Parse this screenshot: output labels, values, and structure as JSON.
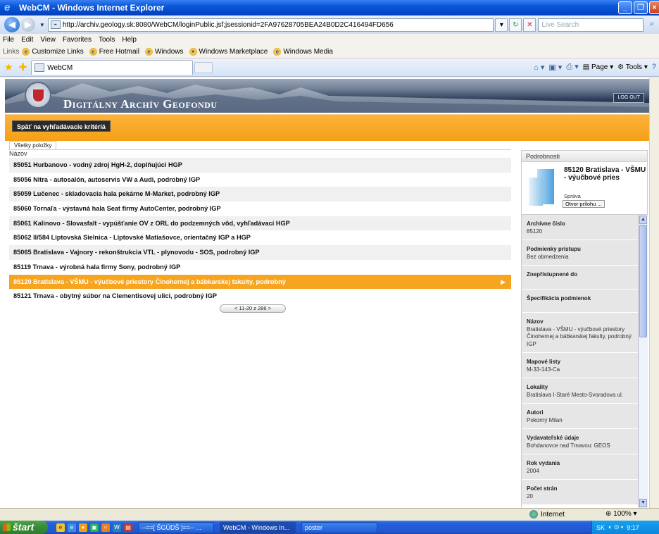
{
  "window": {
    "title": "WebCM - Windows Internet Explorer"
  },
  "address": {
    "url": "http://archiv.geology.sk:8080/WebCM/loginPublic.jsf;jsessionid=2FA97628705BEA24B0D2C416494FD656",
    "search_placeholder": "Live Search"
  },
  "menu": [
    "File",
    "Edit",
    "View",
    "Favorites",
    "Tools",
    "Help"
  ],
  "links": {
    "label": "Links",
    "items": [
      "Customize Links",
      "Free Hotmail",
      "Windows",
      "Windows Marketplace",
      "Windows Media"
    ]
  },
  "tab": {
    "label": "WebCM"
  },
  "commandbar": {
    "page": "Page",
    "tools": "Tools"
  },
  "site": {
    "title": "Digitálny Archív Geofondu",
    "logout": "LOG OUT",
    "back_button": "Späť na vyhľadávacie kritériá",
    "list_tab": "Všetky položky",
    "column_header": "Názov",
    "pager": "< 11-20 z 286 >"
  },
  "results": [
    "85051 Hurbanovo - vodný zdroj HgH-2, doplňujúci HGP",
    "85056 Nitra - autosalón, autoservis VW a Audi, podrobný IGP",
    "85059 Lučenec - skladovacia hala pekárne M-Market, podrobný IGP",
    "85060 Tornaľa - výstavná hala Seat firmy AutoCenter, podrobný IGP",
    "85061 Kalinovo - Slovasfalt - vypúšťanie OV z ORL do podzemných vôd, vyhľadávací HGP",
    "85062 II/584 Liptovská Sielnica - Liptovské Matiašovce, orientačný IGP a HGP",
    "85065 Bratislava - Vajnory - rekonštrukcia VTL - plynovodu - SOS, podrobný IGP",
    "85119 Trnava - výrobná hala firmy Sony, podrobný IGP",
    "85120 Bratislava - VŠMU - výučbové priestory Činohernej a bábkarskej fakulty, podrobný",
    "85121 Trnava - obytný súbor na Clementisovej ulici, podrobný IGP"
  ],
  "details": {
    "header": "Podrobnosti",
    "title": "85120 Bratislava - VŠMU - výučbové pries",
    "sprava": "Správa",
    "otvor": "Otvor prílohu ...",
    "fields": [
      {
        "label": "Archívne číslo",
        "value": "85120"
      },
      {
        "label": "Podmienky prístupu",
        "value": "Bez obmedzenia"
      },
      {
        "label": "Znepřístupnené do",
        "value": ""
      },
      {
        "label": "Špecifikácia podmienok",
        "value": ""
      },
      {
        "label": "Názov",
        "value": "Bratislava - VŠMU - výučbové priestory Činohernej a bábkarskej fakulty, podrobný IGP"
      },
      {
        "label": "Mapové listy",
        "value": "M-33-143-Ca"
      },
      {
        "label": "Lokality",
        "value": "Bratislava I-Staré Mesto-Svoradova ul."
      },
      {
        "label": "Autori",
        "value": "Pokorný Milan"
      },
      {
        "label": "Vydavateľské údaje",
        "value": "Bohdanovce nad Trnavou: GEOS"
      },
      {
        "label": "Rok vydania",
        "value": "2004"
      },
      {
        "label": "Počet strán",
        "value": "20"
      }
    ]
  },
  "status": {
    "zone": "Internet",
    "zoom": "100%"
  },
  "taskbar": {
    "start": "štart",
    "tasks": [
      "--==[ ŠGÚDŠ ]==-- ...",
      "WebCM - Windows In...",
      "poster"
    ],
    "lang": "SK",
    "time": "9:17"
  }
}
